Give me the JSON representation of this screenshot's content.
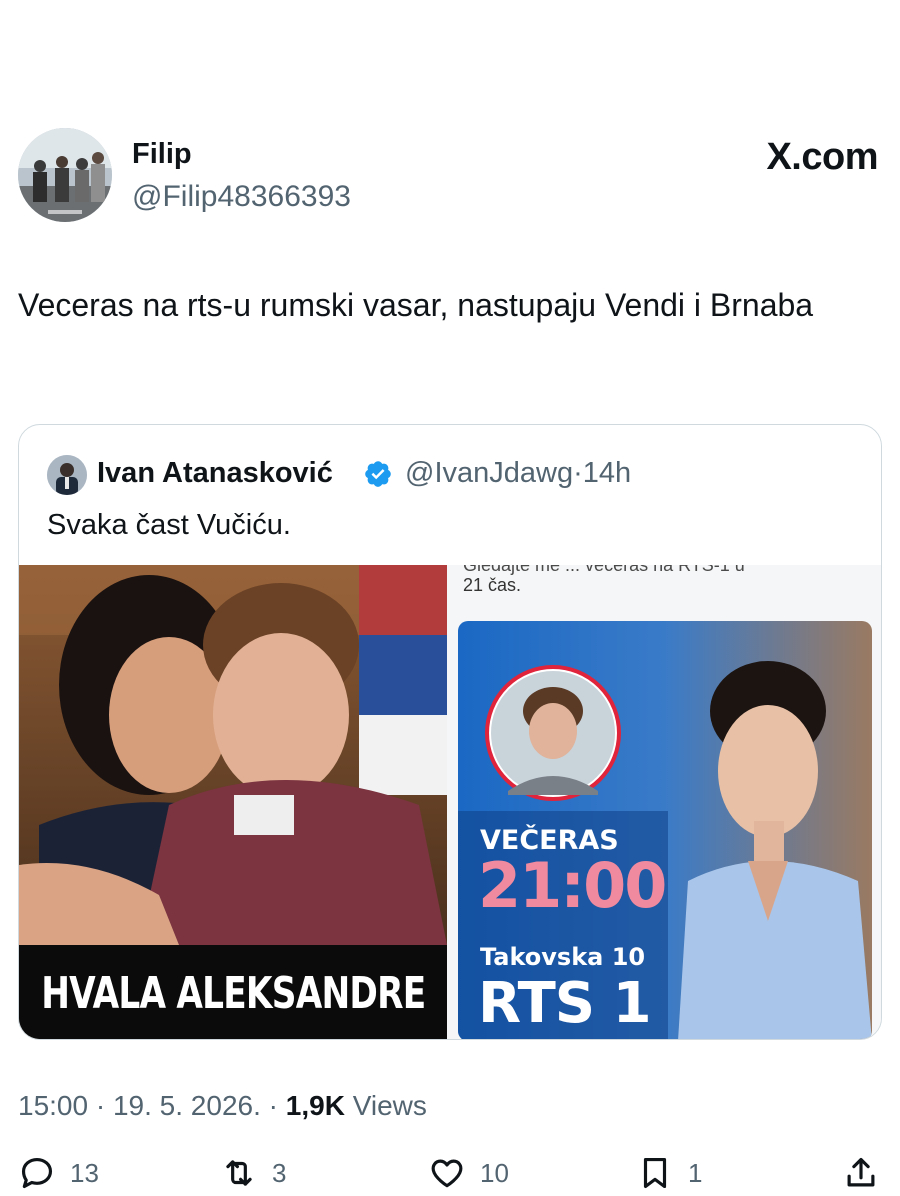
{
  "tweet": {
    "author_name": "Filip",
    "author_handle": "@Filip48366393",
    "brand": "X.com",
    "text": "Veceras na rts-u rumski vasar, nastupaju Vendi i Brnaba",
    "quote": {
      "author_name": "Ivan Atanasković",
      "author_handle": "@IvanJdawg",
      "separator": "·",
      "time": "14h",
      "text": "Svaka čast Vučiću.",
      "image_left_caption": "HVALA ALEKSANDRE",
      "image_right": {
        "cut_line": "Gledajte me ... večeras na RTS-1 u",
        "cut_line_2": "21 čas.",
        "poster_tonight": "VEČERAS",
        "poster_time": "21:00",
        "poster_address": "Takovska 10",
        "poster_channel": "RTS 1"
      }
    },
    "meta": {
      "time": "15:00",
      "date": "19. 5. 2026.",
      "views_count": "1,9K",
      "views_label": "Views"
    },
    "actions": {
      "replies": "13",
      "reposts": "3",
      "likes": "10",
      "bookmarks": "1"
    },
    "colors": {
      "text": "#0f1419",
      "secondary": "#536471",
      "verified": "#1d9bf0",
      "border": "#cfd9de"
    },
    "icons": [
      "reply-icon",
      "repost-icon",
      "like-icon",
      "bookmark-icon",
      "share-icon",
      "verified-icon"
    ]
  }
}
